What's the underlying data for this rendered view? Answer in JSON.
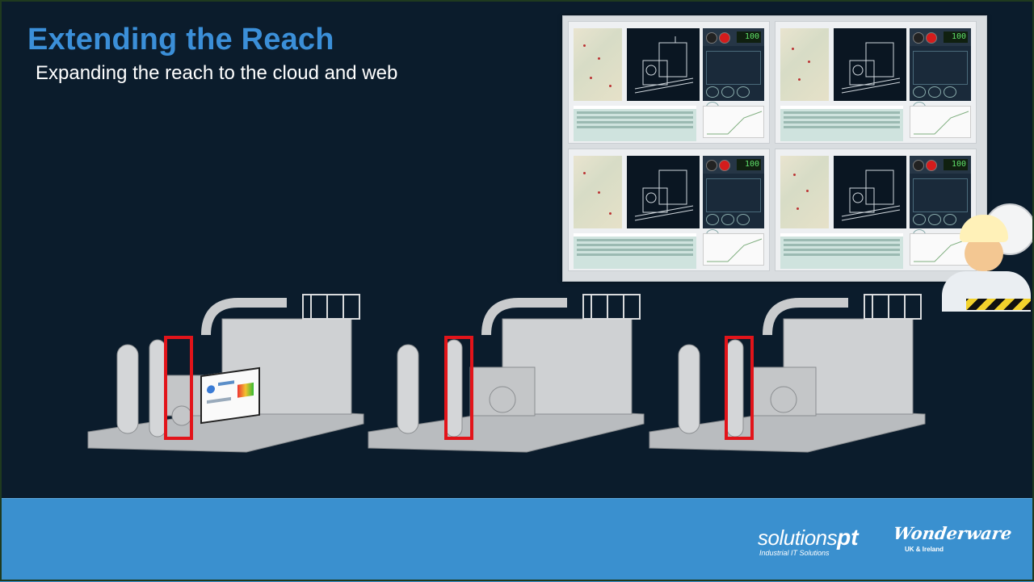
{
  "slide": {
    "title": "Extending the Reach",
    "subtitle": "Expanding the reach to the cloud and web"
  },
  "dashboard": {
    "quadrants": [
      {
        "readout": "100"
      },
      {
        "readout": "100"
      },
      {
        "readout": "100"
      },
      {
        "readout": "100"
      }
    ]
  },
  "compressors": [
    {
      "has_hmi_screen": true
    },
    {
      "has_hmi_screen": false
    },
    {
      "has_hmi_screen": false
    }
  ],
  "footer": {
    "logo_solutions_word": "solutions",
    "logo_solutions_pt": "pt",
    "logo_solutions_tagline": "Industrial IT Solutions",
    "logo_wonderware": "Wonderware",
    "logo_wonderware_region": "UK & Ireland"
  },
  "colors": {
    "slide_bg": "#0b1c2c",
    "title": "#3b8fd8",
    "footer_bg": "#3a90cf",
    "highlight": "#e2141a"
  }
}
